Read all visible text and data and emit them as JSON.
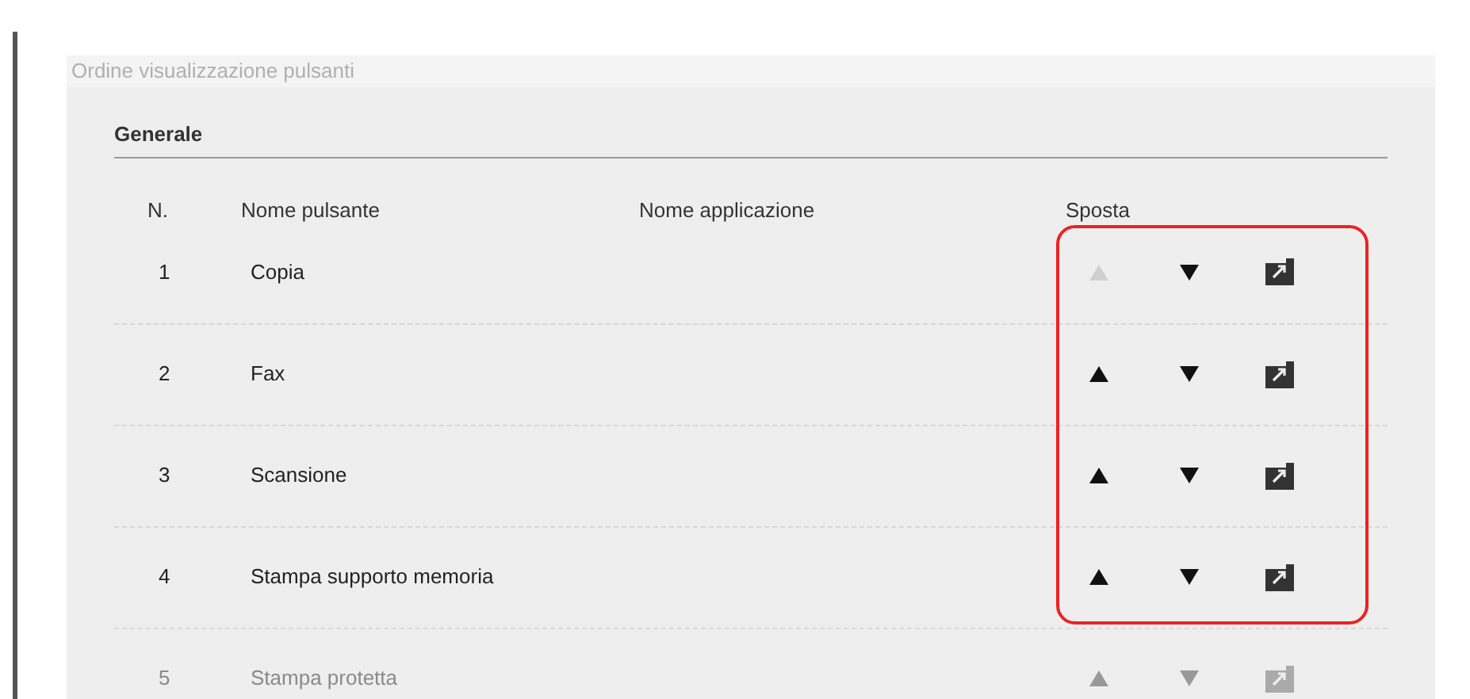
{
  "panel": {
    "title": "Ordine visualizzazione pulsanti"
  },
  "section": {
    "title": "Generale"
  },
  "table": {
    "columns": [
      "N.",
      "Nome pulsante",
      "Nome applicazione",
      "Sposta"
    ],
    "rows": [
      {
        "number": "1",
        "name": "Copia",
        "faded": false,
        "up_disabled": true,
        "down_disabled": false
      },
      {
        "number": "2",
        "name": "Fax",
        "faded": false,
        "up_disabled": false,
        "down_disabled": false
      },
      {
        "number": "3",
        "name": "Scansione",
        "faded": false,
        "up_disabled": false,
        "down_disabled": false
      },
      {
        "number": "4",
        "name": "Stampa supporto memoria",
        "faded": false,
        "up_disabled": false,
        "down_disabled": false
      },
      {
        "number": "5",
        "name": "Stampa protetta",
        "faded": true,
        "up_disabled": false,
        "down_disabled": false
      }
    ]
  }
}
